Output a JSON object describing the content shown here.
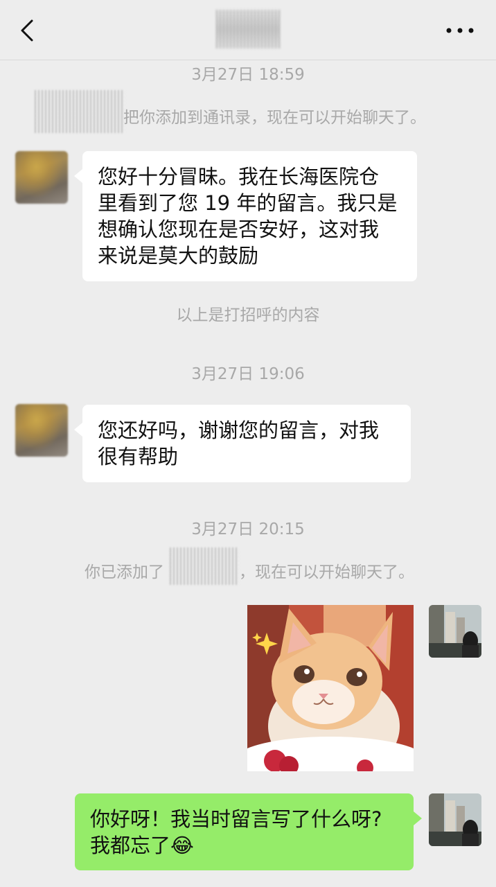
{
  "header": {
    "back_icon": "chevron-left-icon",
    "more_icon": "more-dots-icon"
  },
  "messages": {
    "ts1": "3月27日 18:59",
    "sys1": "把你添加到通讯录，现在可以开始聊天了。",
    "bubble1": {
      "line1": "您好十分冒昧。我在长海医院仓",
      "line2": "里看到了您 19 年的留言。我只是",
      "line3": "想确认您现在是否安好，这对我",
      "line4": "来说是莫大的鼓励"
    },
    "sys_greeting": "以上是打招呼的内容",
    "ts2": "3月27日 19:06",
    "bubble2": {
      "line1": "您还好吗，谢谢您的留言，对我",
      "line2": "很有帮助"
    },
    "ts3": "3月27日 20:15",
    "sys2_prefix": "你已添加了",
    "sys2_suffix": "，现在可以开始聊天了。",
    "sticker": "cat-sticker",
    "bubble3": {
      "line1": "你好呀！我当时留言写了什么呀?",
      "line2": "我都忘了",
      "emoji": "😂"
    }
  },
  "colors": {
    "background": "#ededed",
    "bubble_in": "#ffffff",
    "bubble_out": "#95ec69",
    "system_text": "#a8a8a8"
  }
}
